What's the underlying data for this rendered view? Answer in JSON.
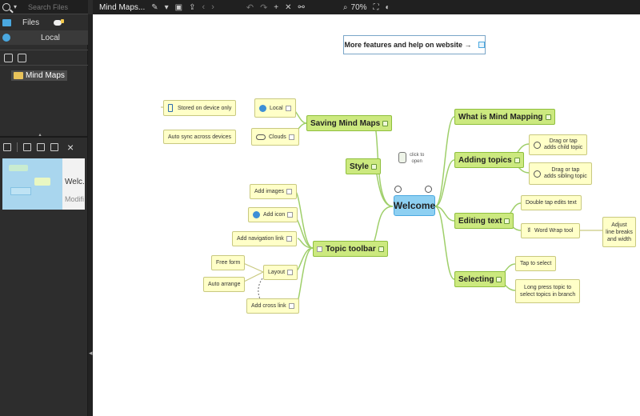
{
  "sidebar": {
    "search_placeholder": "Search Files",
    "files_label": "Files",
    "local_label": "Local",
    "tree_item": "Mind Maps",
    "thumb_name": "Welc...",
    "thumb_modified": "Modifi"
  },
  "toolbar": {
    "tab_title": "Mind Maps...",
    "zoom": "70%"
  },
  "map": {
    "website_box": "More features and help on website →",
    "welcome": "Welcome",
    "click_hint_line1": "click to",
    "click_hint_line2": "open",
    "saving": "Saving Mind Maps",
    "local": "Local",
    "stored_on_device": "Stored on device only",
    "clouds": "Clouds",
    "auto_sync": "Auto sync across devices",
    "style": "Style",
    "topic_toolbar": "Topic toolbar",
    "add_images": "Add images",
    "add_icon": "Add icon",
    "add_nav_link": "Add navigation link",
    "layout": "Layout",
    "free_form": "Free form",
    "auto_arrange": "Auto arrange",
    "add_cross_link": "Add cross link",
    "what_is": "What is Mind Mapping",
    "adding_topics": "Adding topics",
    "drag_child": "Drag or tap\nadds child topic",
    "drag_sibling": "Drag or tap\nadds sibling topic",
    "editing_text": "Editing text",
    "double_tap": "Double tap edits text",
    "word_wrap": "Word Wrap tool",
    "adjust": "Adjust\nline breaks\nand width",
    "selecting": "Selecting",
    "tap_select": "Tap to select",
    "long_press": "Long press topic to\nselect topics in branch"
  },
  "colors": {
    "main_topic_fill": "#cce97f",
    "subtopic_fill": "#ffffc8",
    "central_fill": "#8ed0f2",
    "connector": "#9fcf6a"
  }
}
